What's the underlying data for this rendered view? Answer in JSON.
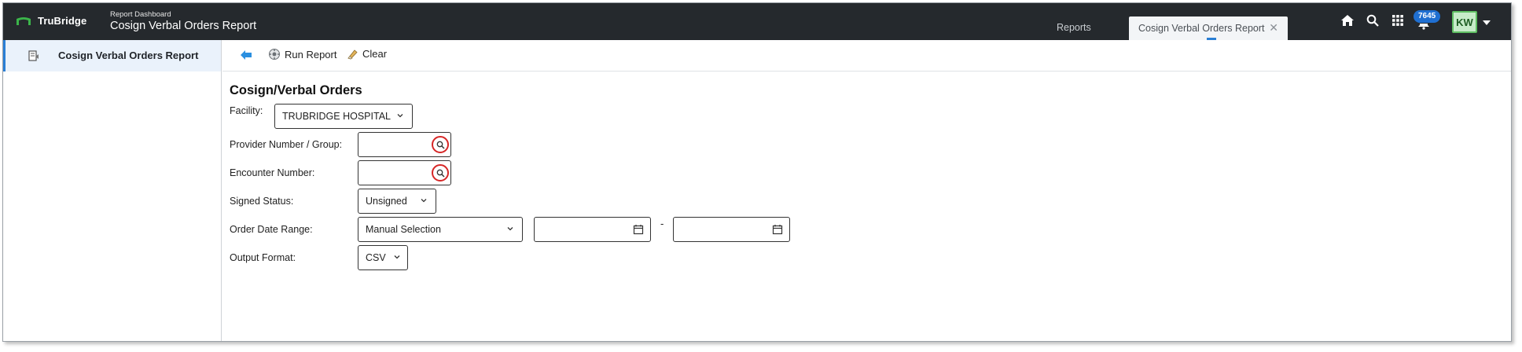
{
  "header": {
    "brand": "TruBridge",
    "crumb_parent": "Report Dashboard",
    "crumb_title": "Cosign Verbal Orders Report",
    "tabs": [
      {
        "label": "Reports"
      },
      {
        "label": "Cosign Verbal Orders Report",
        "active": true
      }
    ],
    "notification_count": "7645",
    "user_initials": "KW"
  },
  "sidebar": {
    "items": [
      {
        "label": "Cosign Verbal Orders Report",
        "active": true
      }
    ]
  },
  "toolbar": {
    "run_label": "Run Report",
    "clear_label": "Clear"
  },
  "form": {
    "title": "Cosign/Verbal Orders",
    "facility": {
      "label": "Facility:",
      "value": "TRUBRIDGE HOSPITAL"
    },
    "provider": {
      "label": "Provider Number / Group:",
      "value": ""
    },
    "encounter": {
      "label": "Encounter Number:",
      "value": ""
    },
    "signed_status": {
      "label": "Signed Status:",
      "value": "Unsigned"
    },
    "order_date_range": {
      "label": "Order Date Range:",
      "value": "Manual Selection",
      "start": "",
      "end": "",
      "separator": "-"
    },
    "output_format": {
      "label": "Output Format:",
      "value": "CSV"
    }
  },
  "colors": {
    "topbar": "#25292d",
    "accent": "#2a7fd5",
    "lookup_ring": "#d62626",
    "badge": "#1f6fd1"
  }
}
